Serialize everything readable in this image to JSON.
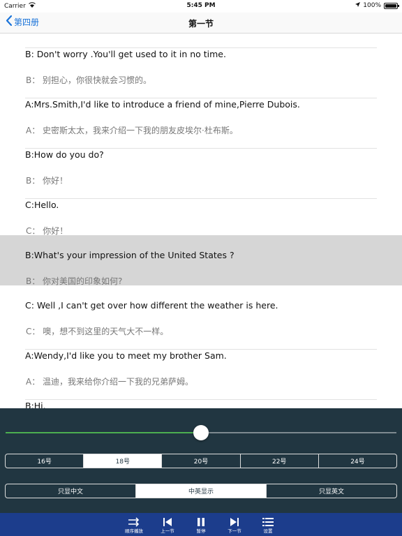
{
  "status_bar": {
    "carrier": "Carrier",
    "time": "5:45 PM",
    "battery": "100%"
  },
  "nav": {
    "back_label": "第四册",
    "title": "第一节"
  },
  "entries": [
    {
      "en": "B: Don't worry .You'll get used to it in no time.",
      "zh": "B： 别担心，你很快就会习惯的。"
    },
    {
      "en": "A:Mrs.Smith,I'd like to introduce a friend of mine,Pierre Dubois.",
      "zh": "A： 史密斯太太，我来介绍一下我的朋友皮埃尔·杜布斯。"
    },
    {
      "en": "B:How do you do?",
      "zh": "B： 你好！"
    },
    {
      "en": "C:Hello.",
      "zh": "C： 你好！"
    },
    {
      "en": "B:What's your impression of the United States ?",
      "zh": "B： 你对美国的印象如何?"
    },
    {
      "en": "C: Well ,I can't get over how different the weather is here.",
      "zh": "C： 噢，想不到这里的天气大不一样。"
    },
    {
      "en": "A:Wendy,I'd like you to meet my brother Sam.",
      "zh": "A： 温迪，我来给你介绍一下我的兄弟萨姆。"
    },
    {
      "en": "B:Hi.",
      "zh": ""
    }
  ],
  "selected_entry_index": 4,
  "slider": {
    "value_fraction": 0.5
  },
  "font_sizes": {
    "options": [
      "16号",
      "18号",
      "20号",
      "22号",
      "24号"
    ],
    "selected": "18号"
  },
  "display_modes": {
    "options": [
      "只显中文",
      "中英显示",
      "只显英文"
    ],
    "selected": "中英显示"
  },
  "toolbar": {
    "order_label": "顺序播放",
    "prev_label": "上一节",
    "pause_label": "暂停",
    "next_label": "下一节",
    "settings_label": "设置"
  },
  "colors": {
    "accent": "#1a73d9",
    "panel_bg": "#213641",
    "toolbar_bg": "#1c3d8c",
    "slider_fill": "#4caf50"
  }
}
